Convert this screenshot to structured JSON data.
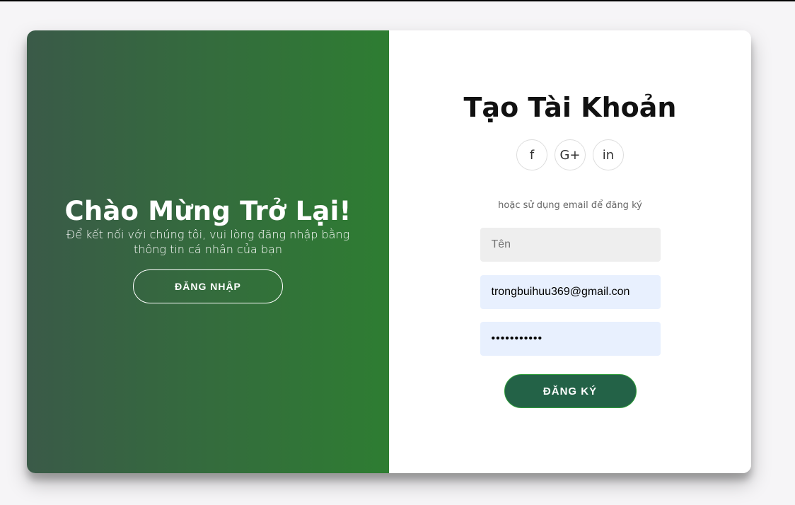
{
  "overlay": {
    "title": "Chào Mừng Trở Lại!",
    "text": "Để kết nối với chúng tôi, vui lòng đăng nhập bằng thông tin cá nhân của bạn",
    "login_button": "ĐĂNG NHẬP"
  },
  "form": {
    "title": "Tạo Tài Khoản",
    "social": [
      {
        "icon": "facebook-icon",
        "label": "f"
      },
      {
        "icon": "google-plus-icon",
        "label": "G+"
      },
      {
        "icon": "linkedin-icon",
        "label": "in"
      }
    ],
    "alt_text": "hoặc sử dụng email để đăng ký",
    "name_placeholder": "Tên",
    "email_value": "trongbuihuu369@gmail.con",
    "password_value": "•••••••••••",
    "submit_button": "ĐĂNG KÝ"
  },
  "colors": {
    "overlay_gradient_start": "#3a5a48",
    "overlay_gradient_end": "#2e7d32",
    "submit_bg": "#236247",
    "autofill_bg": "#e8f0fe",
    "input_bg": "#eeeeee"
  }
}
